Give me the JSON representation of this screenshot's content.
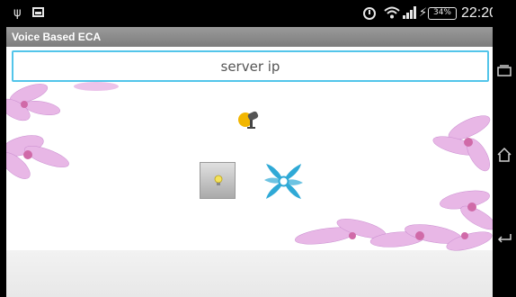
{
  "status_bar": {
    "usb_icon": "usb-icon",
    "picture_icon": "picture-notification-icon",
    "alarm_icon": "alarm-icon",
    "wifi_icon": "wifi-icon",
    "signal_icon": "signal-icon",
    "charging_icon": "charging-icon",
    "battery": "34%",
    "time": "22:20"
  },
  "app": {
    "title": "Voice Based ECA"
  },
  "server_input": {
    "placeholder": "server ip",
    "value": ""
  },
  "controls": {
    "microphone_icon": "microphone-icon",
    "light_icon": "light-bulb-icon",
    "fan_icon": "fan-icon"
  },
  "navigation": {
    "recents_icon": "recents-icon",
    "home_icon": "home-icon",
    "back_icon": "back-icon"
  },
  "colors": {
    "input_border": "#53c5ea",
    "title_bar": "#8a8a8a",
    "status_bar": "#000000",
    "flower_pink": "#d86fb8"
  }
}
